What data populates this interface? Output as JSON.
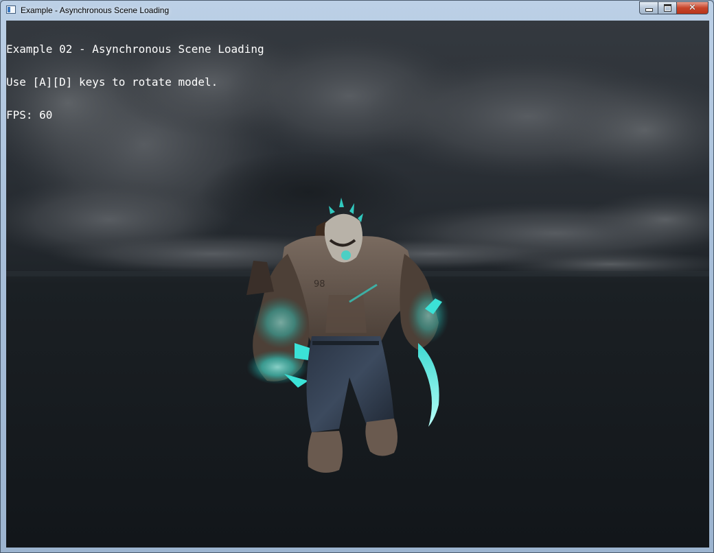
{
  "window": {
    "title": "Example - Asynchronous Scene Loading",
    "controls": {
      "minimize": "minimize-icon",
      "maximize": "maximize-icon",
      "close": "close-icon"
    }
  },
  "hud": {
    "line1": "Example 02 - Asynchronous Scene Loading",
    "line2": "Use [A][D] keys to rotate model.",
    "line3": "FPS: 60"
  },
  "scene": {
    "background": "dark cloudy skybox",
    "model_chest_text": "98",
    "accent_colors": {
      "glow": "#34e0d6",
      "sky": "#2b3036",
      "ground": "#15191d"
    }
  }
}
